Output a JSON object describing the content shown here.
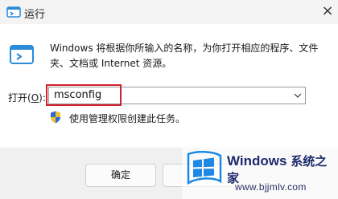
{
  "window": {
    "title": "运行",
    "close_glyph": "×",
    "app_icon": "run-icon"
  },
  "dialog": {
    "description": "Windows 将根据你所输入的名称，为你打开相应的程序、文件夹、文档或 Internet 资源。",
    "open_label_prefix": "打开(",
    "open_label_key": "O",
    "open_label_suffix": "):",
    "input_value": "msconfig",
    "admin_text": "使用管理权限创建此任务。"
  },
  "footer": {
    "ok_label": "确定",
    "cancel_label": ""
  },
  "watermark": {
    "brand": "Windows",
    "brand_suffix": "系统之家",
    "url": "www.bjjmlv.com"
  },
  "colors": {
    "highlight": "#d0202a",
    "shield_blue": "#2b6cd6",
    "shield_yellow": "#f2c12e",
    "logo_blue": "#1e88e5"
  }
}
